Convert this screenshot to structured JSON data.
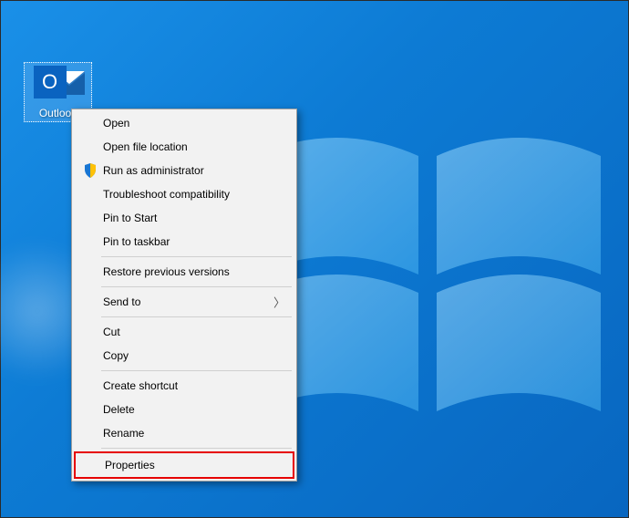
{
  "desktop_icon": {
    "label": "Outlook",
    "letter": "O"
  },
  "context_menu": {
    "groups": [
      [
        {
          "key": "open",
          "label": "Open",
          "icon": null
        },
        {
          "key": "open-file-location",
          "label": "Open file location",
          "icon": null
        },
        {
          "key": "run-as-admin",
          "label": "Run as administrator",
          "icon": "shield"
        },
        {
          "key": "troubleshoot",
          "label": "Troubleshoot compatibility",
          "icon": null
        },
        {
          "key": "pin-start",
          "label": "Pin to Start",
          "icon": null
        },
        {
          "key": "pin-taskbar",
          "label": "Pin to taskbar",
          "icon": null
        }
      ],
      [
        {
          "key": "restore-versions",
          "label": "Restore previous versions",
          "icon": null
        }
      ],
      [
        {
          "key": "send-to",
          "label": "Send to",
          "icon": null,
          "submenu": true
        }
      ],
      [
        {
          "key": "cut",
          "label": "Cut",
          "icon": null
        },
        {
          "key": "copy",
          "label": "Copy",
          "icon": null
        }
      ],
      [
        {
          "key": "create-shortcut",
          "label": "Create shortcut",
          "icon": null
        },
        {
          "key": "delete",
          "label": "Delete",
          "icon": null
        },
        {
          "key": "rename",
          "label": "Rename",
          "icon": null
        }
      ],
      [
        {
          "key": "properties",
          "label": "Properties",
          "icon": null,
          "highlighted": true
        }
      ]
    ]
  }
}
